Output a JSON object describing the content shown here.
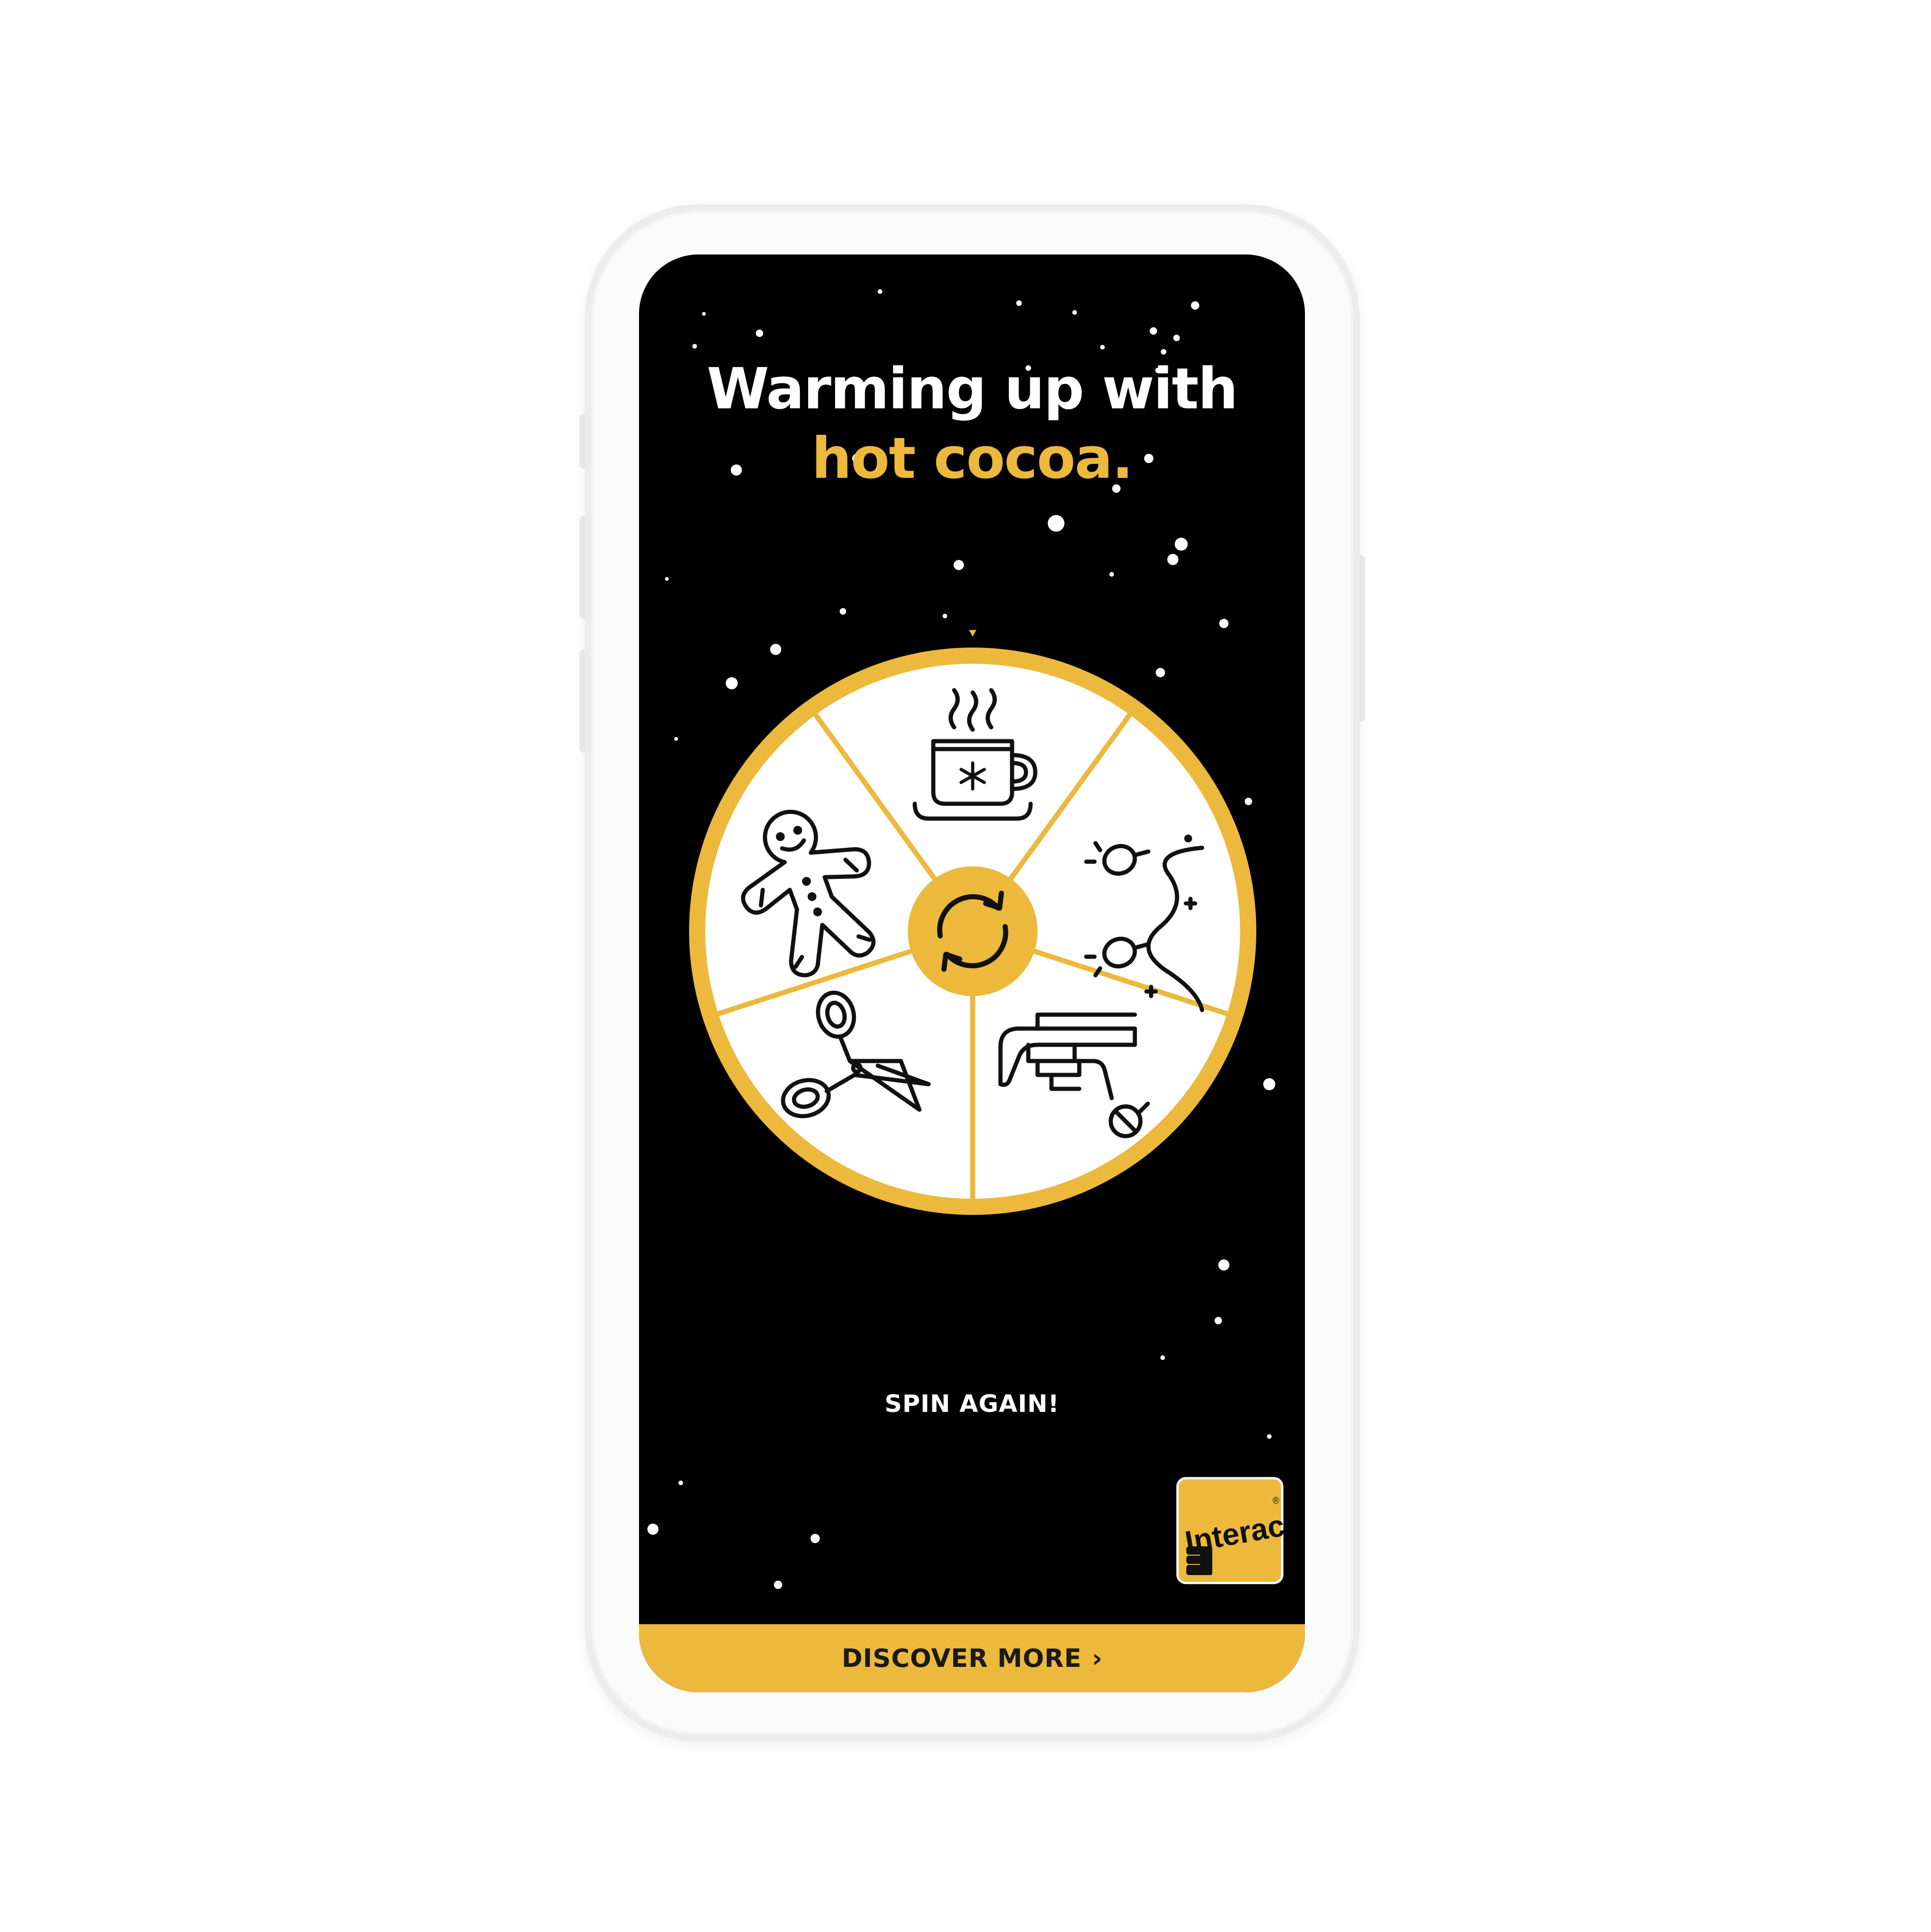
{
  "headline": {
    "line1": "Warming up with",
    "line2": "hot cocoa."
  },
  "wheel": {
    "selected_segment": "hot-cocoa",
    "segments": [
      {
        "name": "hot-cocoa",
        "icon": "hot-cocoa-mug-icon"
      },
      {
        "name": "string-lights",
        "icon": "string-lights-icon"
      },
      {
        "name": "tree-decorating",
        "icon": "glue-gun-ornament-icon"
      },
      {
        "name": "gift-wrapping",
        "icon": "scissors-icon"
      },
      {
        "name": "baking",
        "icon": "gingerbread-man-icon"
      }
    ],
    "center_icon": "refresh-icon",
    "pointer_icon": "map-pin-icon"
  },
  "spin_again_label": "SPIN AGAIN!",
  "logo": {
    "text": "Interac",
    "registered_mark": "®"
  },
  "discover": {
    "label": "DISCOVER MORE",
    "chevron": "›"
  },
  "colors": {
    "accent": "#ecb93d",
    "screen_background": "#000000",
    "headline_text": "#ffffff",
    "wheel_fill": "#ffffff",
    "icon_stroke": "#111111"
  }
}
